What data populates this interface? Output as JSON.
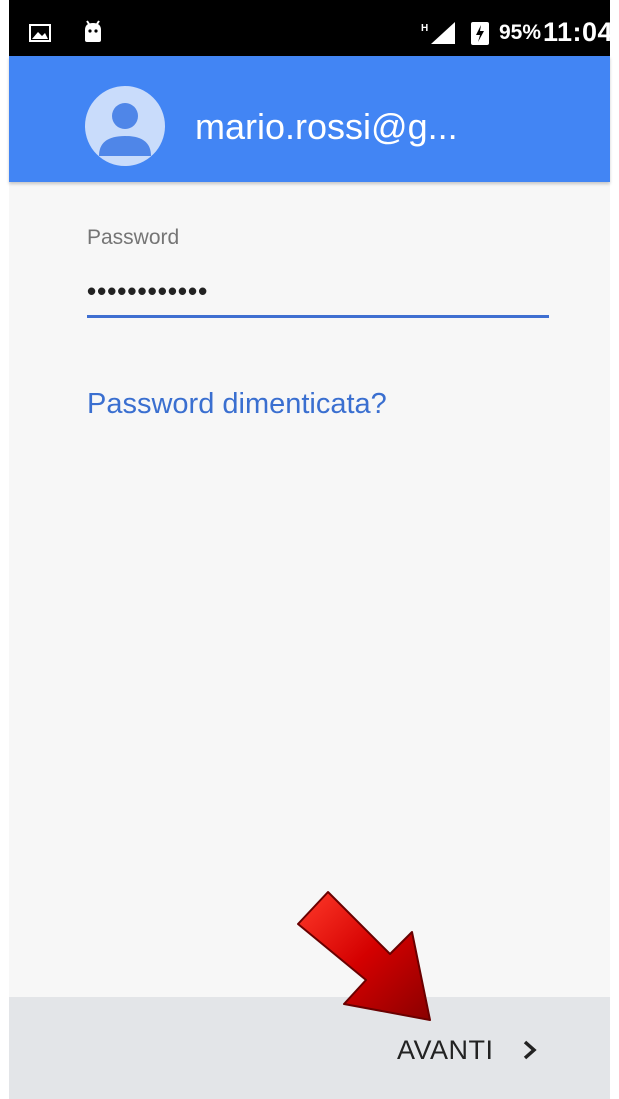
{
  "status_bar": {
    "battery_percent": "95%",
    "time": "11:04",
    "network_type": "H",
    "icons": [
      "gallery-icon",
      "android-icon",
      "signal-icon",
      "battery-charging-icon"
    ]
  },
  "header": {
    "account_email": "mario.rossi@g...",
    "avatar_icon": "account-avatar-icon",
    "background_color": "#4285f4"
  },
  "form": {
    "password_label": "Password",
    "password_value": "••••••••••••",
    "forgot_link": "Password dimenticata?",
    "link_color": "#3a6fd0"
  },
  "footer": {
    "next_label": "AVANTI",
    "next_icon": "chevron-right-icon"
  },
  "overlay": {
    "annotation_icon": "red-arrow-icon",
    "annotation_color": "#d40000"
  }
}
